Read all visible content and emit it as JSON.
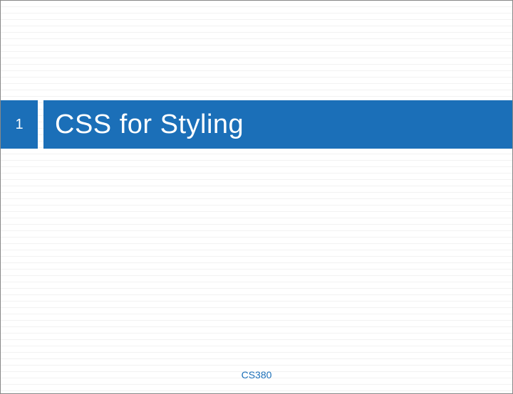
{
  "slide": {
    "number": "1",
    "title": "CSS for Styling",
    "footer": "CS380"
  }
}
